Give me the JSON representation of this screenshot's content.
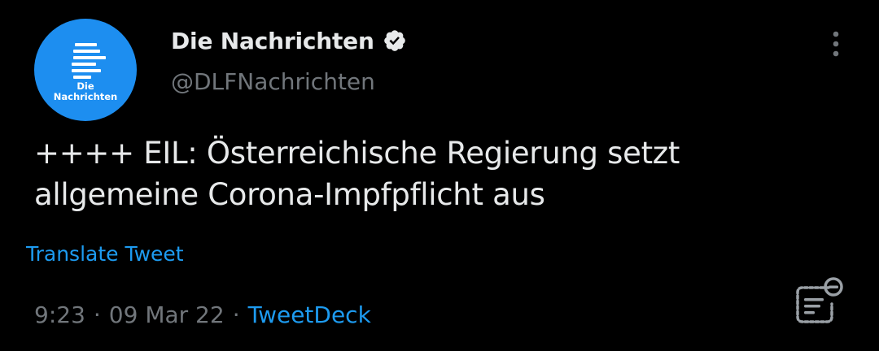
{
  "colors": {
    "background": "#000000",
    "primary_text": "#e7e9ea",
    "secondary_text": "#71767b",
    "accent": "#1d9bf0",
    "avatar_bg": "#1d8ef0"
  },
  "author": {
    "avatar_line1": "Die",
    "avatar_line2": "Nachrichten",
    "display_name": "Die Nachrichten",
    "verified_icon": "verified-badge-icon",
    "handle": "@DLFNachrichten"
  },
  "tweet": {
    "line1": "++++ EIL: Österreichische Regierung setzt",
    "line2": "allgemeine Corona-Impfpflicht aus",
    "translate_label": "Translate Tweet"
  },
  "meta": {
    "time": "9:23",
    "separator": "·",
    "date": "09 Mar 22",
    "source": "TweetDeck"
  },
  "icons": {
    "more": "more-vertical-icon",
    "analytics": "tweet-analytics-icon"
  }
}
